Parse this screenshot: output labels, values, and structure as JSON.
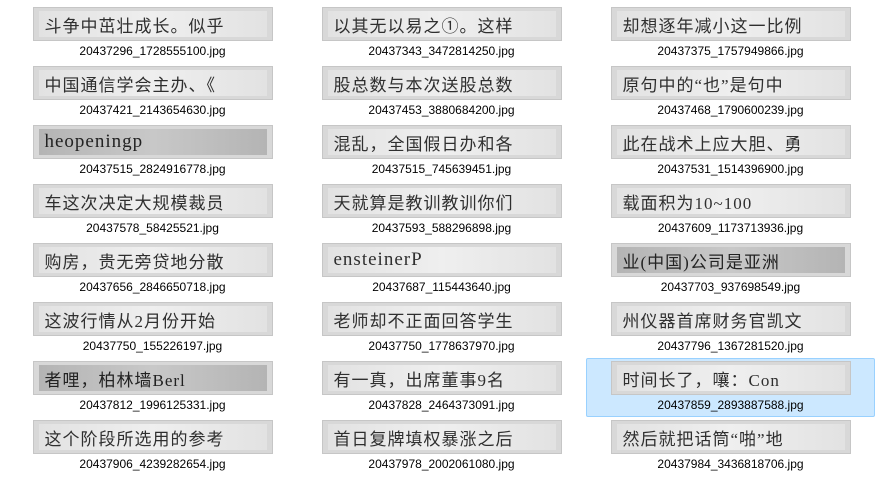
{
  "items": [
    {
      "filename": "20437296_1728555100.jpg",
      "text": "斗争中茁壮成长。似乎",
      "latin": false,
      "dark": false,
      "selected": false
    },
    {
      "filename": "20437343_3472814250.jpg",
      "text": "以其无以易之①。这样",
      "latin": false,
      "dark": false,
      "selected": false
    },
    {
      "filename": "20437375_1757949866.jpg",
      "text": "却想逐年减小这一比例",
      "latin": false,
      "dark": false,
      "selected": false
    },
    {
      "filename": "20437421_2143654630.jpg",
      "text": "中国通信学会主办、《",
      "latin": false,
      "dark": false,
      "selected": false
    },
    {
      "filename": "20437453_3880684200.jpg",
      "text": "股总数与本次送股总数",
      "latin": false,
      "dark": false,
      "selected": false
    },
    {
      "filename": "20437468_1790600239.jpg",
      "text": "原句中的“也”是句中",
      "latin": false,
      "dark": false,
      "selected": false
    },
    {
      "filename": "20437515_2824916778.jpg",
      "text": "heopeningp",
      "latin": true,
      "dark": true,
      "selected": false
    },
    {
      "filename": "20437515_745639451.jpg",
      "text": "混乱，全国假日办和各",
      "latin": false,
      "dark": false,
      "selected": false
    },
    {
      "filename": "20437531_1514396900.jpg",
      "text": "此在战术上应大胆、勇",
      "latin": false,
      "dark": false,
      "selected": false
    },
    {
      "filename": "20437578_58425521.jpg",
      "text": "车这次决定大规模裁员",
      "latin": false,
      "dark": false,
      "selected": false
    },
    {
      "filename": "20437593_588296898.jpg",
      "text": "天就算是教训教训你们",
      "latin": false,
      "dark": false,
      "selected": false
    },
    {
      "filename": "20437609_1173713936.jpg",
      "text": "载面积为10~100",
      "latin": false,
      "dark": false,
      "selected": false
    },
    {
      "filename": "20437656_2846650718.jpg",
      "text": "购房，贵无旁贷地分散",
      "latin": false,
      "dark": false,
      "selected": false
    },
    {
      "filename": "20437687_115443640.jpg",
      "text": "ensteinerP",
      "latin": true,
      "dark": false,
      "selected": false
    },
    {
      "filename": "20437703_937698549.jpg",
      "text": "业(中国)公司是亚洲",
      "latin": false,
      "dark": true,
      "selected": false
    },
    {
      "filename": "20437750_155226197.jpg",
      "text": "这波行情从2月份开始",
      "latin": false,
      "dark": false,
      "selected": false
    },
    {
      "filename": "20437750_1778637970.jpg",
      "text": "老师却不正面回答学生",
      "latin": false,
      "dark": false,
      "selected": false
    },
    {
      "filename": "20437796_1367281520.jpg",
      "text": "州仪器首席财务官凯文",
      "latin": false,
      "dark": false,
      "selected": false
    },
    {
      "filename": "20437812_1996125331.jpg",
      "text": "者哩，柏林墙Berl",
      "latin": false,
      "dark": true,
      "selected": false
    },
    {
      "filename": "20437828_2464373091.jpg",
      "text": "有一真，出席董事9名",
      "latin": false,
      "dark": false,
      "selected": false
    },
    {
      "filename": "20437859_2893887588.jpg",
      "text": "时间长了，嚷：Con",
      "latin": false,
      "dark": false,
      "selected": true
    },
    {
      "filename": "20437906_4239282654.jpg",
      "text": "这个阶段所选用的参考",
      "latin": false,
      "dark": false,
      "selected": false
    },
    {
      "filename": "20437978_2002061080.jpg",
      "text": "首日复牌填权暴涨之后",
      "latin": false,
      "dark": false,
      "selected": false
    },
    {
      "filename": "20437984_3436818706.jpg",
      "text": "然后就把话筒“啪”地",
      "latin": false,
      "dark": false,
      "selected": false
    }
  ]
}
